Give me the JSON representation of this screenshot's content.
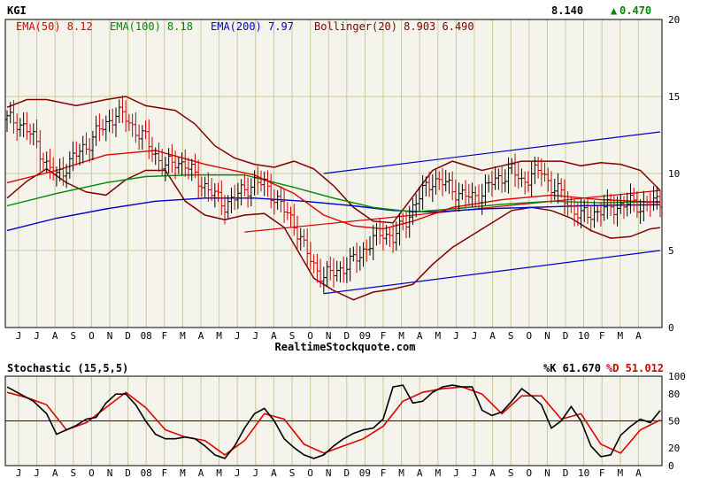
{
  "header": {
    "symbol": "KGI",
    "last_price": "8.140",
    "change_arrow": "▲",
    "change": "0.470",
    "ema50": "EMA(50) 8.12",
    "ema100": "EMA(100) 8.18",
    "ema200": "EMA(200) 7.97",
    "bollinger": "Bollinger(20) 8.903 6.490"
  },
  "stochastic_header": {
    "title": "Stochastic (15,5,5)",
    "k": "%K 61.670",
    "d": "%D 51.012"
  },
  "watermark": "RealtimeStockquote.com",
  "colors": {
    "background": "#f4f4ec",
    "grid": "#c8c89a",
    "ema50": "#dd0000",
    "ema100": "#008800",
    "ema200": "#0000cc",
    "bollinger": "#800000",
    "price_up": "#000000",
    "price_down": "#cc0000",
    "trendline": "#0000cc",
    "stoch_k": "#000000",
    "stoch_d": "#dd0000",
    "change_up": "#008800"
  },
  "chart_data": [
    {
      "type": "line",
      "name": "price",
      "x_labels": [
        "J",
        "J",
        "A",
        "S",
        "O",
        "N",
        "D",
        "08",
        "F",
        "M",
        "A",
        "M",
        "J",
        "J",
        "A",
        "S",
        "O",
        "N",
        "D",
        "09",
        "F",
        "M",
        "A",
        "M",
        "J",
        "J",
        "A",
        "S",
        "O",
        "N",
        "D",
        "10",
        "F",
        "M",
        "A"
      ],
      "ylim": [
        0,
        20
      ],
      "y_ticks": [
        0,
        5,
        10,
        15,
        20
      ],
      "grid": true,
      "price": [
        [
          0,
          13.5
        ],
        [
          3,
          13.4
        ],
        [
          6,
          12.8
        ],
        [
          9,
          12.0
        ],
        [
          12,
          10.5
        ],
        [
          15,
          9.8
        ],
        [
          18,
          10.5
        ],
        [
          21,
          11.2
        ],
        [
          24,
          11.8
        ],
        [
          27,
          12.6
        ],
        [
          30,
          13.2
        ],
        [
          33,
          13.9
        ],
        [
          36,
          13.6
        ],
        [
          39,
          12.8
        ],
        [
          42,
          12.2
        ],
        [
          45,
          11.2
        ],
        [
          48,
          10.4
        ],
        [
          51,
          10.8
        ],
        [
          54,
          10.6
        ],
        [
          57,
          9.8
        ],
        [
          60,
          9.2
        ],
        [
          63,
          8.5
        ],
        [
          66,
          8.0
        ],
        [
          69,
          8.4
        ],
        [
          72,
          9.0
        ],
        [
          75,
          9.4
        ],
        [
          78,
          9.3
        ],
        [
          81,
          8.5
        ],
        [
          84,
          7.6
        ],
        [
          87,
          6.8
        ],
        [
          90,
          5.2
        ],
        [
          93,
          4.0
        ],
        [
          96,
          3.3
        ],
        [
          99,
          3.6
        ],
        [
          102,
          3.9
        ],
        [
          105,
          4.3
        ],
        [
          108,
          5.0
        ],
        [
          111,
          5.7
        ],
        [
          114,
          6.2
        ],
        [
          117,
          5.8
        ],
        [
          120,
          6.6
        ],
        [
          123,
          7.8
        ],
        [
          126,
          8.8
        ],
        [
          129,
          9.6
        ],
        [
          132,
          9.4
        ],
        [
          135,
          9.0
        ],
        [
          138,
          8.6
        ],
        [
          141,
          8.4
        ],
        [
          144,
          8.8
        ],
        [
          147,
          9.4
        ],
        [
          150,
          9.8
        ],
        [
          153,
          10.2
        ],
        [
          156,
          9.5
        ],
        [
          159,
          9.9
        ],
        [
          162,
          10.2
        ],
        [
          165,
          9.2
        ],
        [
          168,
          8.6
        ],
        [
          171,
          7.8
        ],
        [
          174,
          7.2
        ],
        [
          177,
          7.4
        ],
        [
          180,
          7.6
        ],
        [
          183,
          7.8
        ],
        [
          186,
          7.9
        ],
        [
          189,
          8.1
        ],
        [
          192,
          7.9
        ],
        [
          195,
          8.1
        ],
        [
          198,
          8.14
        ]
      ],
      "ema50": [
        [
          0,
          9.4
        ],
        [
          15,
          10.2
        ],
        [
          30,
          11.2
        ],
        [
          45,
          11.5
        ],
        [
          60,
          10.6
        ],
        [
          75,
          9.9
        ],
        [
          87,
          8.7
        ],
        [
          96,
          7.3
        ],
        [
          105,
          6.6
        ],
        [
          114,
          6.4
        ],
        [
          123,
          6.9
        ],
        [
          135,
          7.8
        ],
        [
          150,
          8.3
        ],
        [
          165,
          8.6
        ],
        [
          180,
          8.3
        ],
        [
          198,
          8.12
        ]
      ],
      "ema100": [
        [
          0,
          7.9
        ],
        [
          15,
          8.7
        ],
        [
          30,
          9.4
        ],
        [
          42,
          9.8
        ],
        [
          55,
          9.9
        ],
        [
          72,
          9.9
        ],
        [
          87,
          9.1
        ],
        [
          99,
          8.4
        ],
        [
          111,
          7.8
        ],
        [
          123,
          7.5
        ],
        [
          135,
          7.7
        ],
        [
          150,
          8.0
        ],
        [
          165,
          8.2
        ],
        [
          180,
          8.1
        ],
        [
          198,
          8.18
        ]
      ],
      "ema200": [
        [
          0,
          6.3
        ],
        [
          15,
          7.1
        ],
        [
          30,
          7.7
        ],
        [
          45,
          8.2
        ],
        [
          60,
          8.4
        ],
        [
          75,
          8.4
        ],
        [
          90,
          8.2
        ],
        [
          105,
          7.9
        ],
        [
          117,
          7.6
        ],
        [
          129,
          7.5
        ],
        [
          144,
          7.7
        ],
        [
          159,
          7.8
        ],
        [
          174,
          7.9
        ],
        [
          186,
          7.95
        ],
        [
          198,
          7.97
        ]
      ],
      "bollinger_upper": [
        [
          0,
          14.3
        ],
        [
          6,
          14.8
        ],
        [
          12,
          14.8
        ],
        [
          21,
          14.4
        ],
        [
          30,
          14.8
        ],
        [
          36,
          15.0
        ],
        [
          42,
          14.4
        ],
        [
          51,
          14.1
        ],
        [
          57,
          13.2
        ],
        [
          63,
          11.8
        ],
        [
          69,
          11.0
        ],
        [
          75,
          10.6
        ],
        [
          81,
          10.4
        ],
        [
          87,
          10.8
        ],
        [
          93,
          10.3
        ],
        [
          99,
          9.2
        ],
        [
          105,
          7.8
        ],
        [
          111,
          6.9
        ],
        [
          117,
          6.8
        ],
        [
          123,
          8.5
        ],
        [
          129,
          10.2
        ],
        [
          135,
          10.8
        ],
        [
          144,
          10.2
        ],
        [
          150,
          10.5
        ],
        [
          156,
          10.8
        ],
        [
          162,
          10.8
        ],
        [
          168,
          10.8
        ],
        [
          174,
          10.5
        ],
        [
          180,
          10.7
        ],
        [
          186,
          10.6
        ],
        [
          192,
          10.2
        ],
        [
          198,
          8.903
        ]
      ],
      "bollinger_lower": [
        [
          0,
          8.4
        ],
        [
          6,
          9.5
        ],
        [
          12,
          10.3
        ],
        [
          18,
          9.4
        ],
        [
          24,
          8.8
        ],
        [
          30,
          8.6
        ],
        [
          36,
          9.6
        ],
        [
          42,
          10.2
        ],
        [
          48,
          10.2
        ],
        [
          54,
          8.2
        ],
        [
          60,
          7.3
        ],
        [
          66,
          7.0
        ],
        [
          72,
          7.3
        ],
        [
          78,
          7.4
        ],
        [
          84,
          6.5
        ],
        [
          90,
          4.3
        ],
        [
          93,
          3.2
        ],
        [
          99,
          2.4
        ],
        [
          105,
          1.8
        ],
        [
          111,
          2.3
        ],
        [
          117,
          2.5
        ],
        [
          123,
          2.8
        ],
        [
          129,
          4.1
        ],
        [
          135,
          5.2
        ],
        [
          141,
          6.0
        ],
        [
          147,
          6.8
        ],
        [
          153,
          7.6
        ],
        [
          159,
          7.8
        ],
        [
          165,
          7.6
        ],
        [
          171,
          7.1
        ],
        [
          177,
          6.3
        ],
        [
          183,
          5.8
        ],
        [
          189,
          5.9
        ],
        [
          195,
          6.4
        ],
        [
          198,
          6.49
        ]
      ],
      "trendlines": [
        [
          [
            96,
            2.2
          ],
          [
            198,
            5.0
          ]
        ],
        [
          [
            96,
            10.0
          ],
          [
            198,
            12.7
          ]
        ],
        [
          [
            72,
            6.2
          ],
          [
            198,
            8.9
          ]
        ]
      ]
    },
    {
      "type": "line",
      "ylim": [
        0,
        100
      ],
      "y_ticks": [
        0,
        20,
        50,
        80,
        100
      ],
      "reference_line": 50,
      "k": [
        [
          0,
          88
        ],
        [
          4,
          80
        ],
        [
          8,
          72
        ],
        [
          12,
          58
        ],
        [
          15,
          35
        ],
        [
          18,
          40
        ],
        [
          21,
          45
        ],
        [
          24,
          52
        ],
        [
          27,
          54
        ],
        [
          30,
          70
        ],
        [
          33,
          80
        ],
        [
          36,
          80
        ],
        [
          39,
          68
        ],
        [
          42,
          50
        ],
        [
          45,
          35
        ],
        [
          48,
          30
        ],
        [
          51,
          30
        ],
        [
          54,
          32
        ],
        [
          57,
          30
        ],
        [
          60,
          22
        ],
        [
          63,
          12
        ],
        [
          66,
          8
        ],
        [
          69,
          22
        ],
        [
          72,
          42
        ],
        [
          75,
          58
        ],
        [
          78,
          64
        ],
        [
          81,
          50
        ],
        [
          84,
          30
        ],
        [
          87,
          20
        ],
        [
          90,
          12
        ],
        [
          93,
          8
        ],
        [
          96,
          12
        ],
        [
          99,
          22
        ],
        [
          102,
          30
        ],
        [
          105,
          36
        ],
        [
          108,
          40
        ],
        [
          111,
          42
        ],
        [
          114,
          52
        ],
        [
          117,
          88
        ],
        [
          120,
          90
        ],
        [
          123,
          70
        ],
        [
          126,
          72
        ],
        [
          129,
          82
        ],
        [
          132,
          88
        ],
        [
          135,
          90
        ],
        [
          138,
          88
        ],
        [
          141,
          88
        ],
        [
          144,
          62
        ],
        [
          147,
          56
        ],
        [
          150,
          60
        ],
        [
          153,
          72
        ],
        [
          156,
          86
        ],
        [
          159,
          78
        ],
        [
          162,
          68
        ],
        [
          165,
          42
        ],
        [
          168,
          50
        ],
        [
          171,
          66
        ],
        [
          174,
          50
        ],
        [
          177,
          22
        ],
        [
          180,
          10
        ],
        [
          183,
          12
        ],
        [
          186,
          34
        ],
        [
          189,
          44
        ],
        [
          192,
          52
        ],
        [
          195,
          48
        ],
        [
          198,
          61.67
        ]
      ],
      "d": [
        [
          0,
          82
        ],
        [
          6,
          76
        ],
        [
          12,
          68
        ],
        [
          18,
          40
        ],
        [
          24,
          48
        ],
        [
          30,
          65
        ],
        [
          36,
          82
        ],
        [
          42,
          65
        ],
        [
          48,
          40
        ],
        [
          54,
          32
        ],
        [
          60,
          28
        ],
        [
          66,
          12
        ],
        [
          72,
          28
        ],
        [
          78,
          58
        ],
        [
          84,
          52
        ],
        [
          90,
          24
        ],
        [
          96,
          14
        ],
        [
          102,
          22
        ],
        [
          108,
          30
        ],
        [
          114,
          44
        ],
        [
          120,
          72
        ],
        [
          126,
          82
        ],
        [
          132,
          86
        ],
        [
          138,
          88
        ],
        [
          144,
          80
        ],
        [
          150,
          58
        ],
        [
          156,
          78
        ],
        [
          162,
          78
        ],
        [
          168,
          52
        ],
        [
          174,
          58
        ],
        [
          180,
          24
        ],
        [
          186,
          14
        ],
        [
          192,
          40
        ],
        [
          198,
          51.012
        ]
      ]
    }
  ]
}
